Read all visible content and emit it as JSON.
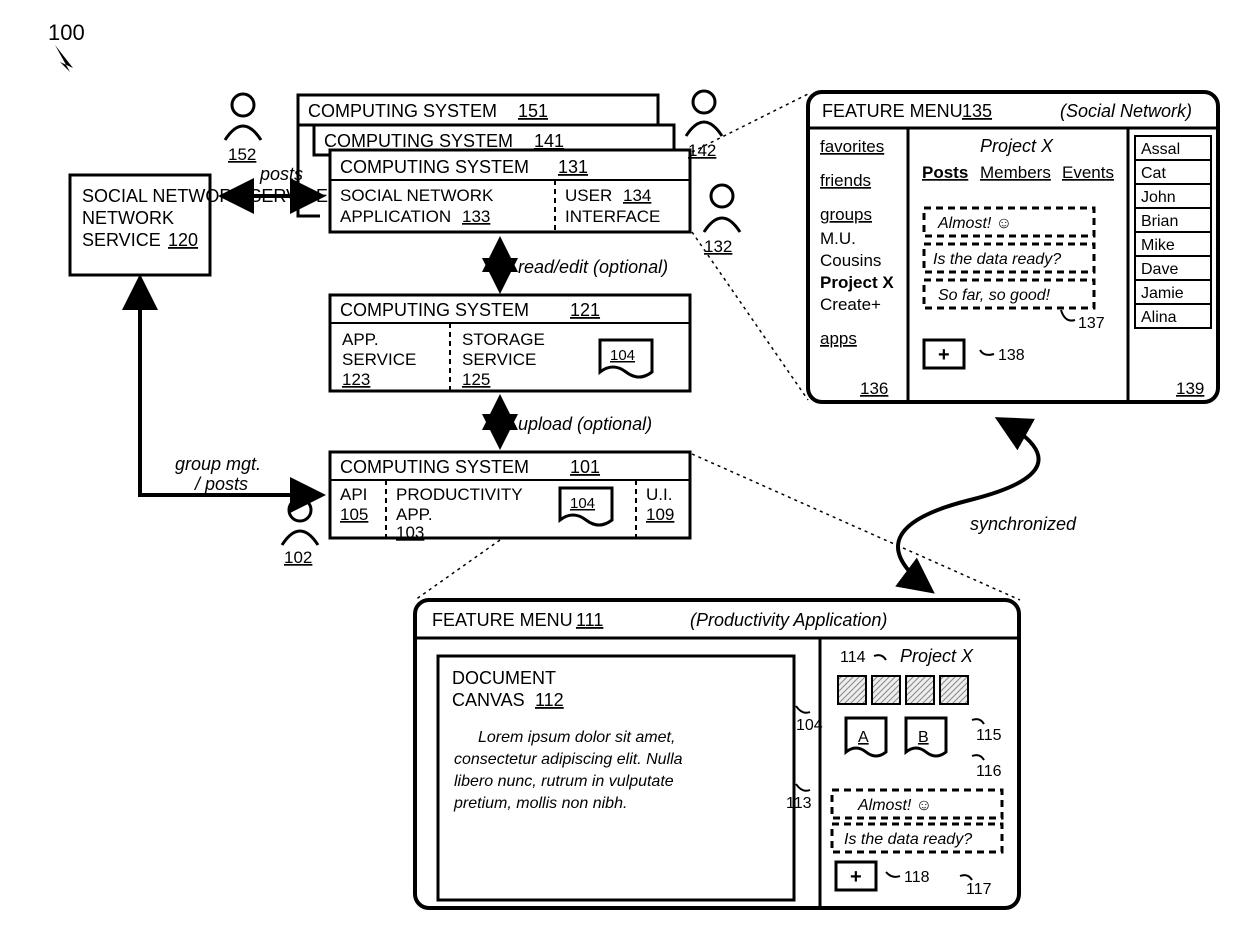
{
  "figureRef": "100",
  "socialNetworkService": {
    "label": "SOCIAL NETWORK SERVICE",
    "ref": "120"
  },
  "computingSystems": {
    "cs151": {
      "label": "COMPUTING SYSTEM",
      "ref": "151"
    },
    "cs141": {
      "label": "COMPUTING SYSTEM",
      "ref": "141"
    },
    "cs131": {
      "label": "COMPUTING SYSTEM",
      "ref": "131",
      "socialApp": {
        "label": "SOCIAL NETWORK APPLICATION",
        "ref": "133"
      },
      "ui": {
        "label": "USER INTERFACE",
        "ref": "134"
      }
    },
    "cs121": {
      "label": "COMPUTING SYSTEM",
      "ref": "121",
      "appService": {
        "label": "APP. SERVICE",
        "ref": "123"
      },
      "storageService": {
        "label": "STORAGE SERVICE",
        "ref": "125"
      },
      "docRef": "104"
    },
    "cs101": {
      "label": "COMPUTING SYSTEM",
      "ref": "101",
      "api": {
        "label": "API",
        "ref": "105"
      },
      "productivityApp": {
        "label": "PRODUCTIVITY APP.",
        "ref": "103"
      },
      "docRef": "104",
      "ui": {
        "label": "U.I.",
        "ref": "109"
      }
    }
  },
  "users": {
    "u152": "152",
    "u142": "142",
    "u132": "132",
    "u102": "102"
  },
  "arrows": {
    "posts": "posts",
    "readEdit": "read/edit (optional)",
    "upload": "upload (optional)",
    "groupMgt": "group mgt. / posts",
    "synchronized": "synchronized"
  },
  "featureMenuSocial": {
    "title": "FEATURE MENU",
    "ref": "135",
    "context": "(Social Network)",
    "sidebar": {
      "favorites": "favorites",
      "friends": "friends",
      "groups": "groups",
      "groupsList": [
        "M.U.",
        "Cousins",
        "Project X",
        "Create+"
      ],
      "apps": "apps",
      "ref": "136"
    },
    "main": {
      "title": "Project X",
      "tabs": {
        "posts": "Posts",
        "members": "Members",
        "events": "Events"
      },
      "posts": [
        "Almost! ☺",
        "Is the data ready?",
        "So far, so good!"
      ],
      "postsRef": "137",
      "addRef": "138"
    },
    "contacts": {
      "list": [
        "Assal",
        "Cat",
        "John",
        "Brian",
        "Mike",
        "Dave",
        "Jamie",
        "Alina"
      ],
      "ref": "139"
    }
  },
  "featureMenuProd": {
    "title": "FEATURE MENU",
    "ref": "111",
    "context": "(Productivity Application)",
    "canvas": {
      "label": "DOCUMENT CANVAS",
      "ref": "112",
      "body": "Lorem ipsum dolor sit amet, consectetur adipiscing elit. Nulla libero nunc, rutrum in vulputate pretium, mollis non nibh."
    },
    "docRef": "104",
    "side": {
      "projectRef": "114",
      "project": "Project X",
      "panelRef": "113",
      "docA": "A",
      "docARef": "115",
      "docB": "B",
      "docBRef": "116",
      "posts": [
        "Almost! ☺",
        "Is the data ready?"
      ],
      "postsRef": "117",
      "addRef": "118"
    }
  }
}
